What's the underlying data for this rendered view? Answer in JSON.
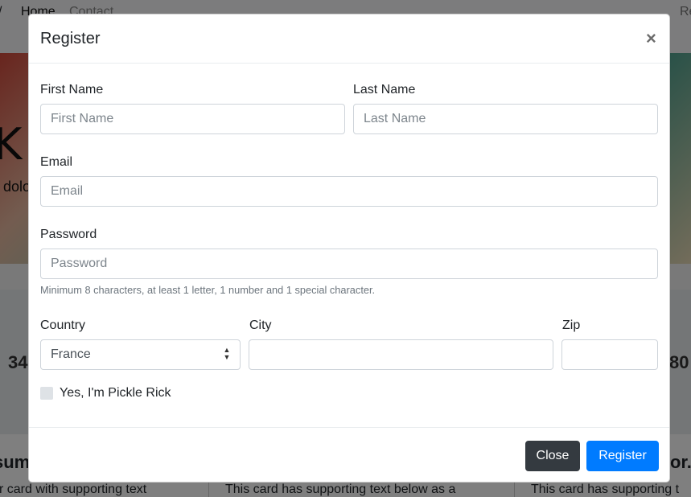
{
  "background": {
    "nav": {
      "edge_char": "/",
      "home": "Home",
      "contact": "Contact",
      "right_link": "Re"
    },
    "hero": {
      "big_char": "K",
      "partial_text": "dolo"
    },
    "stats": {
      "left": "34",
      "right": "80"
    },
    "cards": [
      {
        "title": "sum",
        "text": "r card with supporting text"
      },
      {
        "title": "",
        "text": "This card has supporting text below as a"
      },
      {
        "title": "or.",
        "text": "This card has supporting t"
      }
    ]
  },
  "modal": {
    "title": "Register",
    "close_icon": "×",
    "first_name": {
      "label": "First Name",
      "placeholder": "First Name",
      "value": ""
    },
    "last_name": {
      "label": "Last Name",
      "placeholder": "Last Name",
      "value": ""
    },
    "email": {
      "label": "Email",
      "placeholder": "Email",
      "value": ""
    },
    "password": {
      "label": "Password",
      "placeholder": "Password",
      "value": "",
      "help": "Minimum 8 characters, at least 1 letter, 1 number and 1 special character."
    },
    "country": {
      "label": "Country",
      "selected": "France",
      "arrows": "▲▼"
    },
    "city": {
      "label": "City",
      "value": ""
    },
    "zip": {
      "label": "Zip",
      "value": ""
    },
    "checkbox": {
      "label": "Yes, I'm Pickle Rick",
      "checked": false
    },
    "footer": {
      "close_label": "Close",
      "register_label": "Register"
    }
  },
  "colors": {
    "primary": "#007bff",
    "dark": "#343a40",
    "backdrop": "rgba(0,0,0,0.5)"
  }
}
